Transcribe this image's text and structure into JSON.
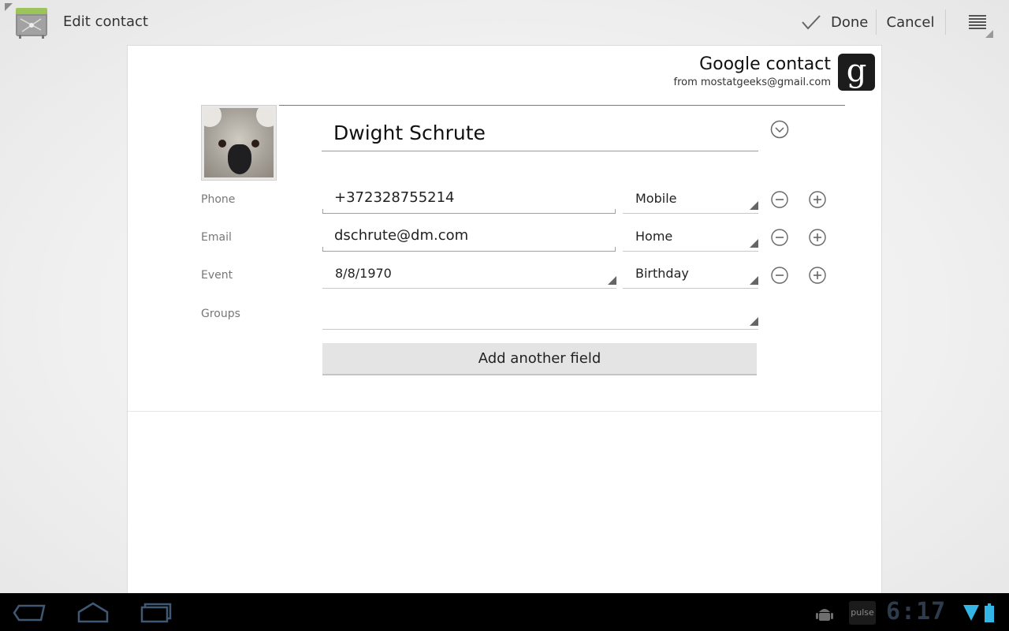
{
  "actionbar": {
    "app_icon": "contacts-app-icon",
    "title": "Edit contact",
    "done_label": "Done",
    "cancel_label": "Cancel",
    "overflow_icon": "overflow-menu-icon"
  },
  "account": {
    "type": "Google contact",
    "name": "from mostatgeeks@gmail.com",
    "logo_letter": "g"
  },
  "contact": {
    "name": "Dwight Schrute"
  },
  "fields": {
    "phone": {
      "label": "Phone",
      "value": "+372328755214",
      "type": "Mobile"
    },
    "email": {
      "label": "Email",
      "value": "dschrute@dm.com",
      "type": "Home"
    },
    "event": {
      "label": "Event",
      "value": "8/8/1970",
      "type": "Birthday"
    },
    "groups": {
      "label": "Groups",
      "value": ""
    }
  },
  "add_field_label": "Add another field",
  "sysbar": {
    "clock": "6:17",
    "pulse_label": "pulse"
  },
  "colors": {
    "background": "#f0f0f0",
    "card": "#ffffff",
    "system_bar": "#000000",
    "accent_blue": "#33b5e5"
  }
}
